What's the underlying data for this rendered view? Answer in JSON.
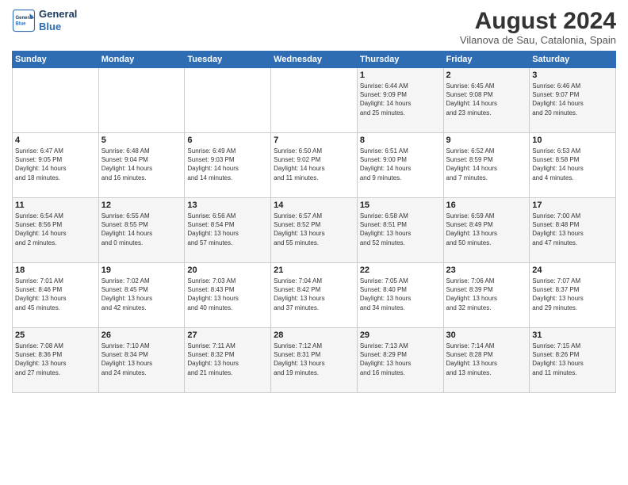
{
  "header": {
    "logo": {
      "line1": "General",
      "line2": "Blue"
    },
    "title": "August 2024",
    "location": "Vilanova de Sau, Catalonia, Spain"
  },
  "weekdays": [
    "Sunday",
    "Monday",
    "Tuesday",
    "Wednesday",
    "Thursday",
    "Friday",
    "Saturday"
  ],
  "weeks": [
    [
      {
        "day": "",
        "info": ""
      },
      {
        "day": "",
        "info": ""
      },
      {
        "day": "",
        "info": ""
      },
      {
        "day": "",
        "info": ""
      },
      {
        "day": "1",
        "info": "Sunrise: 6:44 AM\nSunset: 9:09 PM\nDaylight: 14 hours\nand 25 minutes."
      },
      {
        "day": "2",
        "info": "Sunrise: 6:45 AM\nSunset: 9:08 PM\nDaylight: 14 hours\nand 23 minutes."
      },
      {
        "day": "3",
        "info": "Sunrise: 6:46 AM\nSunset: 9:07 PM\nDaylight: 14 hours\nand 20 minutes."
      }
    ],
    [
      {
        "day": "4",
        "info": "Sunrise: 6:47 AM\nSunset: 9:05 PM\nDaylight: 14 hours\nand 18 minutes."
      },
      {
        "day": "5",
        "info": "Sunrise: 6:48 AM\nSunset: 9:04 PM\nDaylight: 14 hours\nand 16 minutes."
      },
      {
        "day": "6",
        "info": "Sunrise: 6:49 AM\nSunset: 9:03 PM\nDaylight: 14 hours\nand 14 minutes."
      },
      {
        "day": "7",
        "info": "Sunrise: 6:50 AM\nSunset: 9:02 PM\nDaylight: 14 hours\nand 11 minutes."
      },
      {
        "day": "8",
        "info": "Sunrise: 6:51 AM\nSunset: 9:00 PM\nDaylight: 14 hours\nand 9 minutes."
      },
      {
        "day": "9",
        "info": "Sunrise: 6:52 AM\nSunset: 8:59 PM\nDaylight: 14 hours\nand 7 minutes."
      },
      {
        "day": "10",
        "info": "Sunrise: 6:53 AM\nSunset: 8:58 PM\nDaylight: 14 hours\nand 4 minutes."
      }
    ],
    [
      {
        "day": "11",
        "info": "Sunrise: 6:54 AM\nSunset: 8:56 PM\nDaylight: 14 hours\nand 2 minutes."
      },
      {
        "day": "12",
        "info": "Sunrise: 6:55 AM\nSunset: 8:55 PM\nDaylight: 14 hours\nand 0 minutes."
      },
      {
        "day": "13",
        "info": "Sunrise: 6:56 AM\nSunset: 8:54 PM\nDaylight: 13 hours\nand 57 minutes."
      },
      {
        "day": "14",
        "info": "Sunrise: 6:57 AM\nSunset: 8:52 PM\nDaylight: 13 hours\nand 55 minutes."
      },
      {
        "day": "15",
        "info": "Sunrise: 6:58 AM\nSunset: 8:51 PM\nDaylight: 13 hours\nand 52 minutes."
      },
      {
        "day": "16",
        "info": "Sunrise: 6:59 AM\nSunset: 8:49 PM\nDaylight: 13 hours\nand 50 minutes."
      },
      {
        "day": "17",
        "info": "Sunrise: 7:00 AM\nSunset: 8:48 PM\nDaylight: 13 hours\nand 47 minutes."
      }
    ],
    [
      {
        "day": "18",
        "info": "Sunrise: 7:01 AM\nSunset: 8:46 PM\nDaylight: 13 hours\nand 45 minutes."
      },
      {
        "day": "19",
        "info": "Sunrise: 7:02 AM\nSunset: 8:45 PM\nDaylight: 13 hours\nand 42 minutes."
      },
      {
        "day": "20",
        "info": "Sunrise: 7:03 AM\nSunset: 8:43 PM\nDaylight: 13 hours\nand 40 minutes."
      },
      {
        "day": "21",
        "info": "Sunrise: 7:04 AM\nSunset: 8:42 PM\nDaylight: 13 hours\nand 37 minutes."
      },
      {
        "day": "22",
        "info": "Sunrise: 7:05 AM\nSunset: 8:40 PM\nDaylight: 13 hours\nand 34 minutes."
      },
      {
        "day": "23",
        "info": "Sunrise: 7:06 AM\nSunset: 8:39 PM\nDaylight: 13 hours\nand 32 minutes."
      },
      {
        "day": "24",
        "info": "Sunrise: 7:07 AM\nSunset: 8:37 PM\nDaylight: 13 hours\nand 29 minutes."
      }
    ],
    [
      {
        "day": "25",
        "info": "Sunrise: 7:08 AM\nSunset: 8:36 PM\nDaylight: 13 hours\nand 27 minutes."
      },
      {
        "day": "26",
        "info": "Sunrise: 7:10 AM\nSunset: 8:34 PM\nDaylight: 13 hours\nand 24 minutes."
      },
      {
        "day": "27",
        "info": "Sunrise: 7:11 AM\nSunset: 8:32 PM\nDaylight: 13 hours\nand 21 minutes."
      },
      {
        "day": "28",
        "info": "Sunrise: 7:12 AM\nSunset: 8:31 PM\nDaylight: 13 hours\nand 19 minutes."
      },
      {
        "day": "29",
        "info": "Sunrise: 7:13 AM\nSunset: 8:29 PM\nDaylight: 13 hours\nand 16 minutes."
      },
      {
        "day": "30",
        "info": "Sunrise: 7:14 AM\nSunset: 8:28 PM\nDaylight: 13 hours\nand 13 minutes."
      },
      {
        "day": "31",
        "info": "Sunrise: 7:15 AM\nSunset: 8:26 PM\nDaylight: 13 hours\nand 11 minutes."
      }
    ]
  ],
  "colors": {
    "header_bg": "#2e6db4",
    "accent": "#1a3a5c"
  }
}
